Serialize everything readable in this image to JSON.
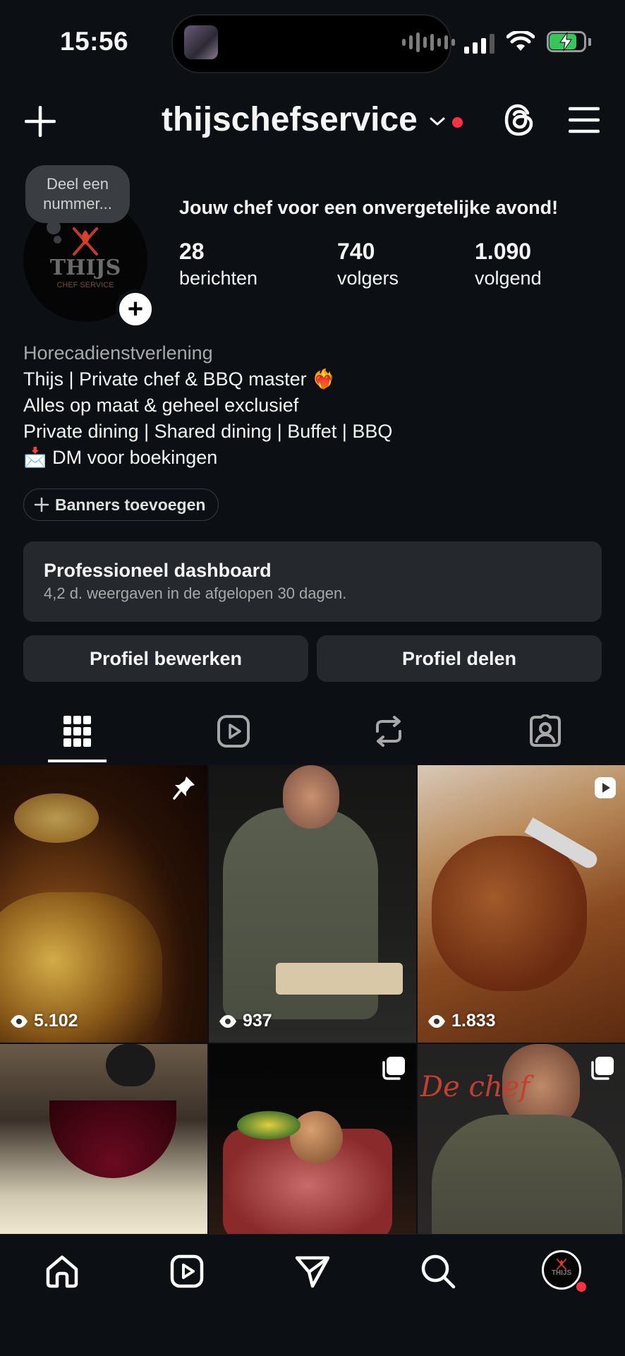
{
  "status_bar": {
    "time": "15:56"
  },
  "header": {
    "username": "thijschefservice"
  },
  "profile": {
    "note": "Deel een nummer...",
    "avatar_text": {
      "top": "THIJS",
      "bottom": "CHEF SERVICE"
    },
    "headline": "Jouw chef voor een onvergetelijke avond!",
    "stats": [
      {
        "value": "28",
        "label": "berichten"
      },
      {
        "value": "740",
        "label": "volgers"
      },
      {
        "value": "1.090",
        "label": "volgend"
      }
    ],
    "category": "Horecadienstverlening",
    "bio_lines": [
      "Thijs | Private chef & BBQ master ❤️‍🔥",
      "Alles op maat & geheel exclusief",
      "Private dining | Shared dining | Buffet | BBQ",
      "📩 DM voor boekingen"
    ],
    "banners_button": "Banners toevoegen"
  },
  "dashboard": {
    "title": "Professioneel dashboard",
    "subtitle": "4,2 d. weergaven in de afgelopen 30 dagen."
  },
  "actions": {
    "edit": "Profiel bewerken",
    "share": "Profiel delen"
  },
  "tabs": [
    "grid-icon",
    "reels-icon",
    "reposts-icon",
    "tagged-icon"
  ],
  "grid": {
    "posts": [
      {
        "views": "5.102",
        "badge": "pin-icon"
      },
      {
        "views": "937",
        "badge": ""
      },
      {
        "views": "1.833",
        "badge": "reel-icon"
      },
      {
        "views": "",
        "badge": ""
      },
      {
        "views": "",
        "badge": "carousel-icon"
      },
      {
        "views": "",
        "badge": "carousel-icon",
        "overlay_text": "De chef"
      }
    ]
  },
  "nav": [
    "home-icon",
    "reels-icon",
    "messages-icon",
    "search-icon",
    "profile-avatar"
  ],
  "colors": {
    "background": "#0c1014",
    "card": "#25292e",
    "notification": "#ff3040",
    "battery": "#34c759"
  }
}
